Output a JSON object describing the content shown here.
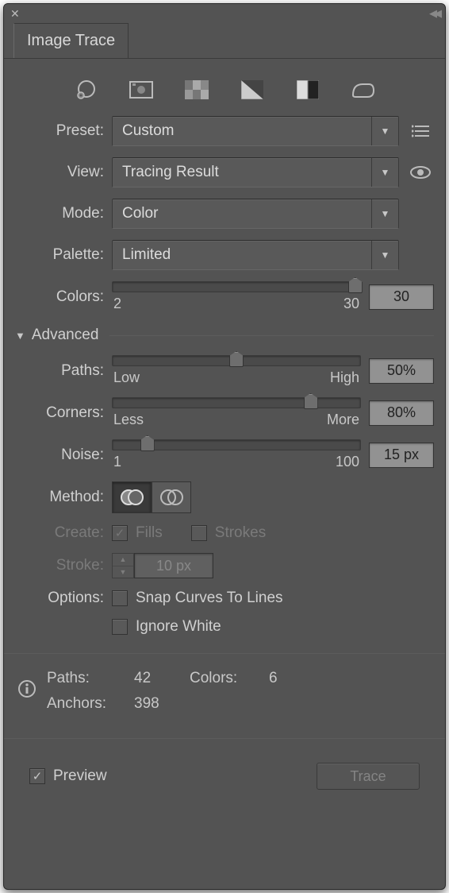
{
  "panel": {
    "title": "Image Trace"
  },
  "icons": {
    "auto": "auto-color-icon",
    "high": "high-color-icon",
    "low": "low-color-icon",
    "gray": "grayscale-icon",
    "bw": "black-white-icon",
    "outline": "outline-icon"
  },
  "preset": {
    "label": "Preset:",
    "value": "Custom"
  },
  "view": {
    "label": "View:",
    "value": "Tracing Result"
  },
  "mode": {
    "label": "Mode:",
    "value": "Color"
  },
  "palette": {
    "label": "Palette:",
    "value": "Limited"
  },
  "colors": {
    "label": "Colors:",
    "value": "30",
    "min": "2",
    "max": "30"
  },
  "advanced": {
    "title": "Advanced"
  },
  "paths": {
    "label": "Paths:",
    "value": "50%",
    "lowLabel": "Low",
    "highLabel": "High"
  },
  "corners": {
    "label": "Corners:",
    "value": "80%",
    "lowLabel": "Less",
    "highLabel": "More"
  },
  "noise": {
    "label": "Noise:",
    "value": "15 px",
    "min": "1",
    "max": "100"
  },
  "method": {
    "label": "Method:"
  },
  "create": {
    "label": "Create:",
    "fillsLabel": "Fills",
    "strokesLabel": "Strokes"
  },
  "stroke": {
    "label": "Stroke:",
    "value": "10 px"
  },
  "options": {
    "label": "Options:",
    "snapLabel": "Snap Curves To Lines",
    "ignoreLabel": "Ignore White"
  },
  "info": {
    "pathsLabel": "Paths:",
    "pathsVal": "42",
    "colorsLabel": "Colors:",
    "colorsVal": "6",
    "anchorsLabel": "Anchors:",
    "anchorsVal": "398"
  },
  "footer": {
    "previewLabel": "Preview",
    "traceLabel": "Trace"
  }
}
